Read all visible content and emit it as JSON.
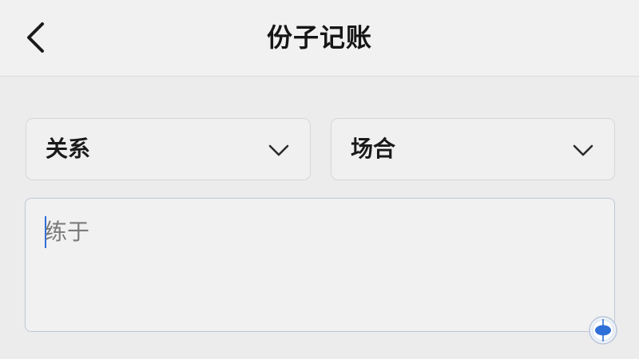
{
  "header": {
    "title": "份子记账",
    "back_icon": "chevron-left-icon"
  },
  "filters": {
    "relation": {
      "label": "关系",
      "icon": "chevron-down-icon"
    },
    "occasion": {
      "label": "场合",
      "icon": "chevron-down-icon"
    }
  },
  "note": {
    "value": "练于"
  },
  "colors": {
    "caret": "#2f6fd8",
    "handle": "#2f6fd8"
  }
}
